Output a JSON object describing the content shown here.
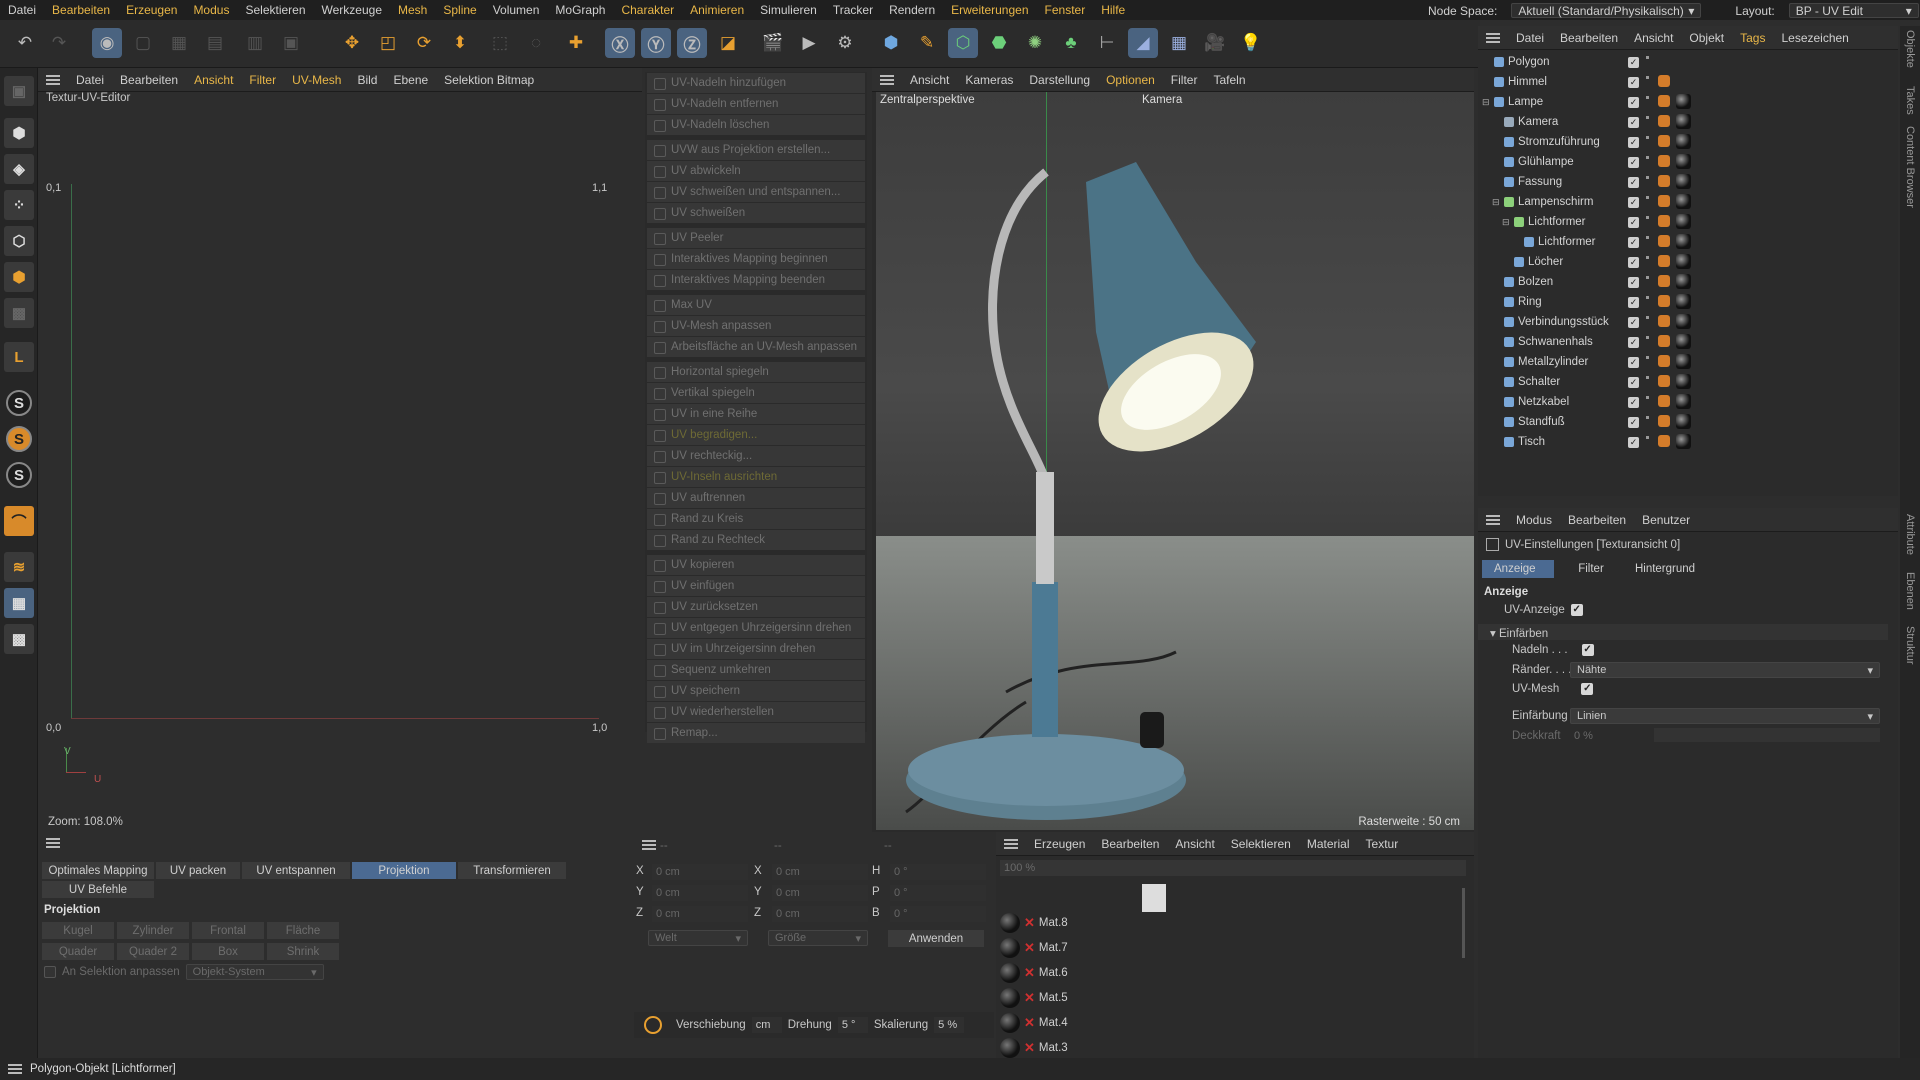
{
  "menu": [
    "Datei",
    "Bearbeiten",
    "Erzeugen",
    "Modus",
    "Selektieren",
    "Werkzeuge",
    "Mesh",
    "Spline",
    "Volumen",
    "MoGraph",
    "Charakter",
    "Animieren",
    "Simulieren",
    "Tracker",
    "Rendern",
    "Erweiterungen",
    "Fenster",
    "Hilfe"
  ],
  "menu_highlight": [
    1,
    2,
    3,
    6,
    7,
    10,
    11,
    15,
    16,
    17
  ],
  "node_space": {
    "label": "Node Space:",
    "value": "Aktuell (Standard/Physikalisch)"
  },
  "layout": {
    "label": "Layout:",
    "value": "BP - UV Edit"
  },
  "uv_editor": {
    "menu": [
      "Datei",
      "Bearbeiten",
      "Ansicht",
      "Filter",
      "UV-Mesh",
      "Bild",
      "Ebene",
      "Selektion Bitmap"
    ],
    "menu_hl": [
      2,
      3,
      4
    ],
    "title": "Textur-UV-Editor",
    "tl": "0,1",
    "tr": "1,1",
    "bl": "0,0",
    "br": "1,0",
    "axis_v": "V",
    "axis_u": "U",
    "zoom": "Zoom: 108.0%"
  },
  "uv_commands": [
    [
      "UV-Nadeln hinzufügen",
      "UV-Nadeln entfernen",
      "UV-Nadeln löschen"
    ],
    [
      "UVW aus Projektion erstellen...",
      "UV abwickeln",
      "UV schweißen und entspannen...",
      "UV schweißen"
    ],
    [
      "UV Peeler",
      "Interaktives Mapping beginnen",
      "Interaktives Mapping beenden"
    ],
    [
      "Max UV",
      "UV-Mesh anpassen",
      "Arbeitsfläche an UV-Mesh anpassen"
    ],
    [
      "Horizontal spiegeln",
      "Vertikal spiegeln",
      "UV in eine Reihe",
      "UV begradigen...",
      "UV rechteckig...",
      "UV-Inseln ausrichten",
      "UV auftrennen",
      "Rand zu Kreis",
      "Rand zu Rechteck"
    ],
    [
      "UV kopieren",
      "UV einfügen",
      "UV zurücksetzen",
      "UV entgegen Uhrzeigersinn drehen",
      "UV im Uhrzeigersinn drehen",
      "Sequenz umkehren",
      "UV speichern",
      "UV wiederherstellen",
      "Remap..."
    ]
  ],
  "viewport": {
    "menu": [
      "Ansicht",
      "Kameras",
      "Darstellung",
      "Optionen",
      "Filter",
      "Tafeln"
    ],
    "menu_hl": [
      3
    ],
    "perspective": "Zentralperspektive",
    "camera": "Kamera",
    "grid": "Rasterweite : 50 cm"
  },
  "objects": {
    "menu": [
      "Datei",
      "Bearbeiten",
      "Ansicht",
      "Objekt",
      "Tags",
      "Lesezeichen"
    ],
    "menu_hl": [
      4
    ],
    "rows": [
      {
        "name": "Polygon",
        "indent": 0,
        "color": "#7aa7d8"
      },
      {
        "name": "Himmel",
        "indent": 0,
        "color": "#7aa7d8"
      },
      {
        "name": "Lampe",
        "indent": 0,
        "color": "#7aa7d8"
      },
      {
        "name": "Kamera",
        "indent": 1,
        "color": "#9ab"
      },
      {
        "name": "Stromzuführung",
        "indent": 1,
        "color": "#7aa7d8"
      },
      {
        "name": "Glühlampe",
        "indent": 1,
        "color": "#7aa7d8"
      },
      {
        "name": "Fassung",
        "indent": 1,
        "color": "#7aa7d8"
      },
      {
        "name": "Lampenschirm",
        "indent": 1,
        "color": "#8cd07a"
      },
      {
        "name": "Lichtformer",
        "indent": 2,
        "color": "#8cd07a"
      },
      {
        "name": "Lichtformer",
        "indent": 3,
        "color": "#7aa7d8"
      },
      {
        "name": "Löcher",
        "indent": 2,
        "color": "#7aa7d8"
      },
      {
        "name": "Bolzen",
        "indent": 1,
        "color": "#7aa7d8"
      },
      {
        "name": "Ring",
        "indent": 1,
        "color": "#7aa7d8"
      },
      {
        "name": "Verbindungsstück",
        "indent": 1,
        "color": "#7aa7d8"
      },
      {
        "name": "Schwanenhals",
        "indent": 1,
        "color": "#7aa7d8"
      },
      {
        "name": "Metallzylinder",
        "indent": 1,
        "color": "#7aa7d8"
      },
      {
        "name": "Schalter",
        "indent": 1,
        "color": "#7aa7d8"
      },
      {
        "name": "Netzkabel",
        "indent": 1,
        "color": "#7aa7d8"
      },
      {
        "name": "Standfuß",
        "indent": 1,
        "color": "#7aa7d8"
      },
      {
        "name": "Tisch",
        "indent": 1,
        "color": "#7aa7d8"
      }
    ]
  },
  "attributes": {
    "menu": [
      "Modus",
      "Bearbeiten",
      "Benutzer"
    ],
    "title": "UV-Einstellungen [Texturansicht 0]",
    "tabs": [
      "Anzeige",
      "Filter",
      "Hintergrund"
    ],
    "section": "Anzeige",
    "uv_display": "UV-Anzeige",
    "group": "Einfärben",
    "pins": "Nadeln . . .",
    "edges": "Ränder. . . .",
    "edges_val": "Nähte",
    "uvmesh": "UV-Mesh",
    "coloring": "Einfärbung",
    "coloring_val": "Linien",
    "opacity": "Deckkraft",
    "opacity_val": "0 %"
  },
  "uvtools": {
    "tabs": [
      "Optimales Mapping",
      "UV packen",
      "UV entspannen",
      "Projektion",
      "Transformieren"
    ],
    "tab2": "UV Befehle",
    "section": "Projektion",
    "buttons": [
      "Kugel",
      "Zylinder",
      "Frontal",
      "Fläche",
      "Quader",
      "Quader 2",
      "Box",
      "Shrink"
    ],
    "fit": "An Selektion anpassen",
    "system": "Objekt-System"
  },
  "coords": {
    "dashes": [
      "--",
      "--",
      "--"
    ],
    "rows": [
      [
        "X",
        "0 cm",
        "X",
        "0 cm",
        "H",
        "0 °"
      ],
      [
        "Y",
        "0 cm",
        "Y",
        "0 cm",
        "P",
        "0 °"
      ],
      [
        "Z",
        "0 cm",
        "Z",
        "0 cm",
        "B",
        "0 °"
      ]
    ],
    "world": "Welt",
    "size": "Größe",
    "apply": "Anwenden",
    "shift": "Verschiebung",
    "shift_unit": "cm",
    "rot": "Drehung",
    "rot_val": "5 °",
    "scale": "Skalierung",
    "scale_val": "5 %"
  },
  "materials": {
    "menu": [
      "Erzeugen",
      "Bearbeiten",
      "Ansicht",
      "Selektieren",
      "Material",
      "Textur"
    ],
    "zoom": "100 %",
    "items": [
      "Mat.8",
      "Mat.7",
      "Mat.6",
      "Mat.5",
      "Mat.4",
      "Mat.3"
    ]
  },
  "status": "Polygon-Objekt [Lichtformer]",
  "side_tabs": [
    "Objekte",
    "Takes",
    "Content Browser",
    "Attribute",
    "Ebenen",
    "Struktur"
  ]
}
